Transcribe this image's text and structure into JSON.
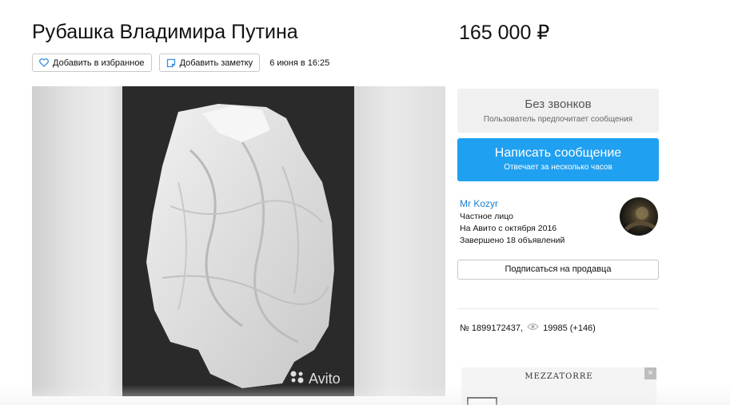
{
  "listing": {
    "title": "Рубашка Владимира Путина",
    "price": "165 000 ₽",
    "favorite_label": "Добавить в избранное",
    "note_label": "Добавить заметку",
    "date": "6 июня в 16:25",
    "watermark": "Avito",
    "listing_number": "№ 1899172437,",
    "views": "19985 (+146)"
  },
  "contact": {
    "no_calls_title": "Без звонков",
    "no_calls_subtitle": "Пользователь предпочитает сообщения",
    "write_title": "Написать сообщение",
    "write_subtitle": "Отвечает за несколько часов"
  },
  "seller": {
    "name": "Mr Kozyr",
    "type": "Частное лицо",
    "since": "На Авито с октября 2016",
    "completed": "Завершено 18 объявлений",
    "subscribe_label": "Подписаться на продавца"
  },
  "ad": {
    "brand": "MEZZATORRE",
    "close": "×"
  },
  "colors": {
    "accent": "#20a0f0",
    "seller_link": "#1e7fd0",
    "icon_blue": "#3a8ee6"
  },
  "icons": [
    "heart-icon",
    "note-icon",
    "eye-icon",
    "close-icon",
    "avito-logo-icon"
  ]
}
